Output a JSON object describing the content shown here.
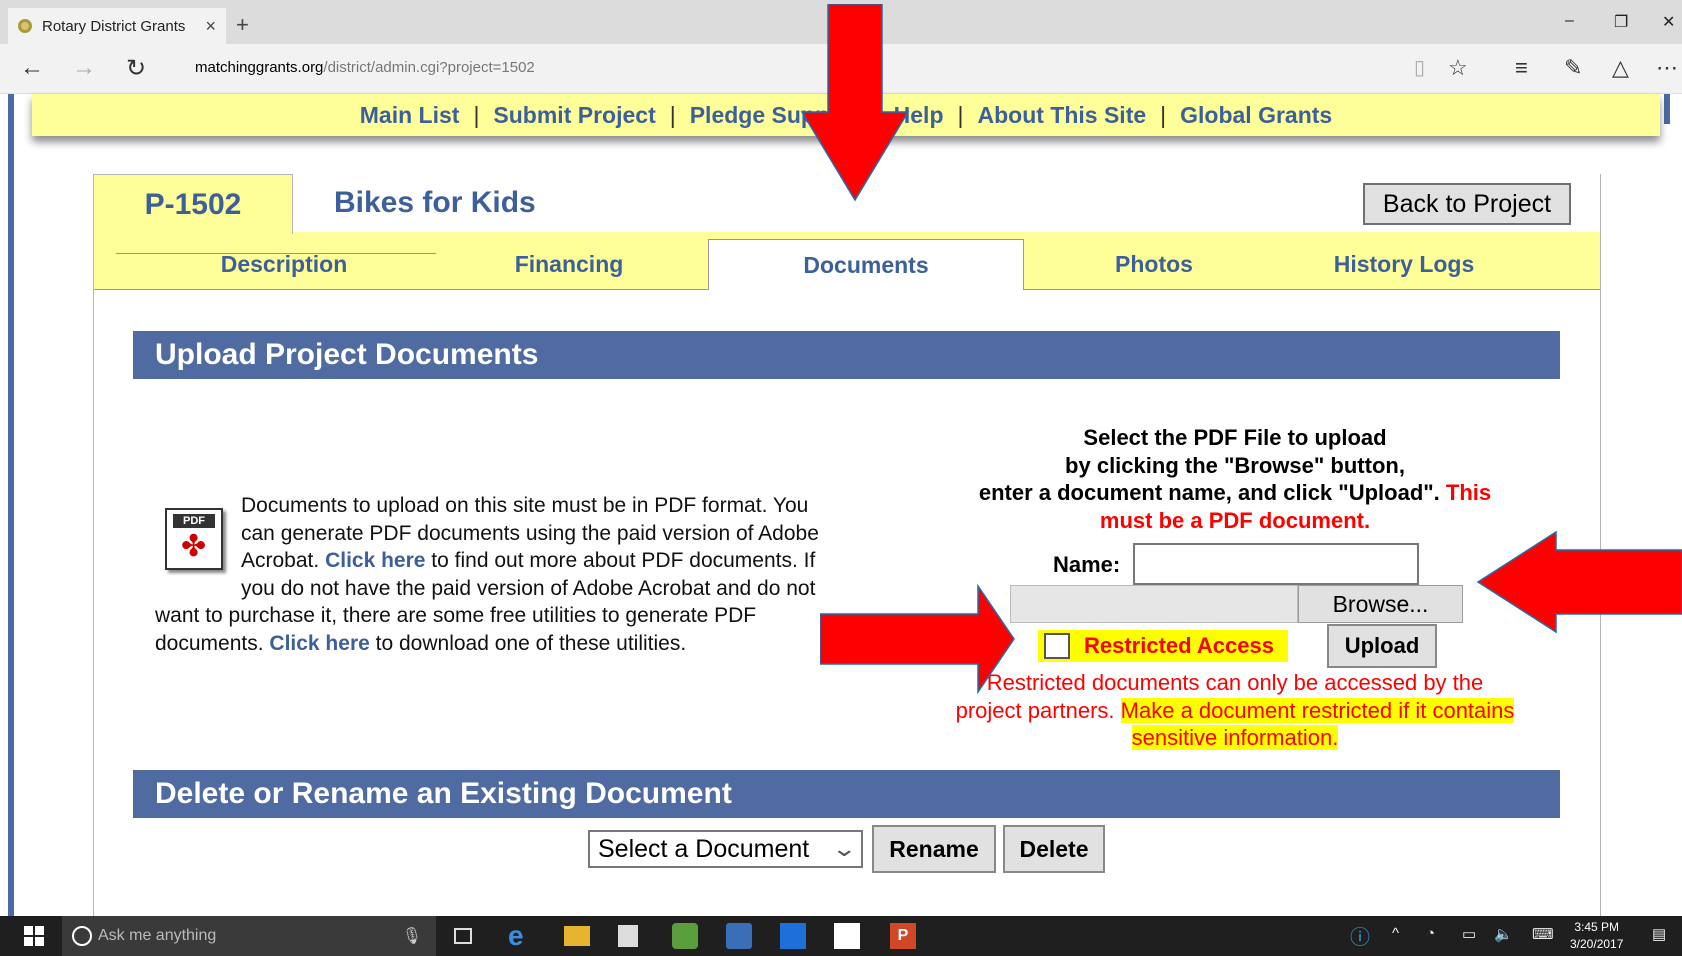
{
  "browser": {
    "tab_title": "Rotary District Grants",
    "tab_close": "×",
    "new_tab": "+",
    "url_host": "matchinggrants.org",
    "url_path": "/district/admin.cgi?project=1502"
  },
  "topnav": {
    "items": [
      "Main List",
      "Submit Project",
      "Pledge Support",
      "Help",
      "About This Site",
      "Global Grants"
    ],
    "sep": "|"
  },
  "project": {
    "id": "P-1502",
    "name": "Bikes for Kids",
    "back_label": "Back to Project"
  },
  "subtabs": [
    "Description",
    "Financing",
    "Documents",
    "Photos",
    "History Logs"
  ],
  "active_subtab": "Documents",
  "upload": {
    "heading": "Upload Project Documents",
    "icon_label": "PDF",
    "info_line1": "Documents to upload on this site must be in PDF format. You",
    "info_line2": "can generate PDF documents using the paid version of Adobe",
    "info_line3a": "Acrobat.",
    "info_link1": "Click here",
    "info_line3b": "to find out more about PDF documents. If",
    "info_line4": "you do not have the paid version of Adobe Acrobat and do not",
    "info_line5": "want to purchase it, there are some free utilities to generate PDF",
    "info_line6a": "documents.",
    "info_link2": "Click here",
    "info_line6b": "to download one of these utilities.",
    "select_line1": "Select the PDF File to upload",
    "select_line2": "by clicking the \"Browse\" button,",
    "select_line3": "enter a document name, and click \"Upload\".",
    "select_red": "This must be a PDF document.",
    "name_label": "Name:",
    "name_value": "",
    "browse_label": "Browse...",
    "restricted_label": "Restricted Access",
    "restricted_checked": false,
    "upload_label": "Upload",
    "note_plain": "Restricted documents can only be accessed by the project partners.",
    "note_highlight": "Make a document restricted if it contains sensitive information."
  },
  "manage": {
    "heading": "Delete or Rename an Existing Document",
    "select_value": "Select a Document",
    "rename_label": "Rename",
    "delete_label": "Delete"
  },
  "taskbar": {
    "search_placeholder": "Ask me anything",
    "time": "3:45 PM",
    "date": "3/20/2017"
  },
  "colors": {
    "nav_yellow": "#ffff99",
    "link_blue": "#3d609a",
    "section_blue": "#4f6ba1",
    "alert_red": "#ff0000",
    "highlight_yellow": "#ffff00",
    "arrow_red": "#ff0000"
  }
}
